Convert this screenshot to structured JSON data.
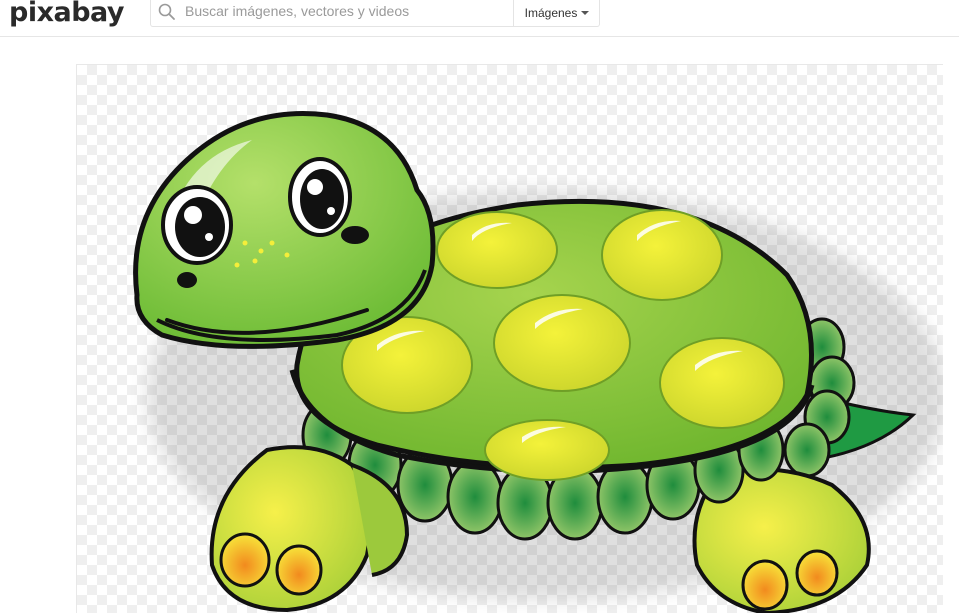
{
  "header": {
    "logo": "pixabay",
    "search": {
      "placeholder": "Buscar imágenes, vectores y videos",
      "value": ""
    },
    "media_type": {
      "selected": "Imágenes"
    }
  },
  "image": {
    "subject": "turtle-illustration",
    "colors": {
      "shell": "#8ac53a",
      "spots": "#e9e82b",
      "outline": "#111111",
      "skin": "#7dc43d",
      "feet": "#f3ea25",
      "toes": "#f7a320"
    }
  }
}
